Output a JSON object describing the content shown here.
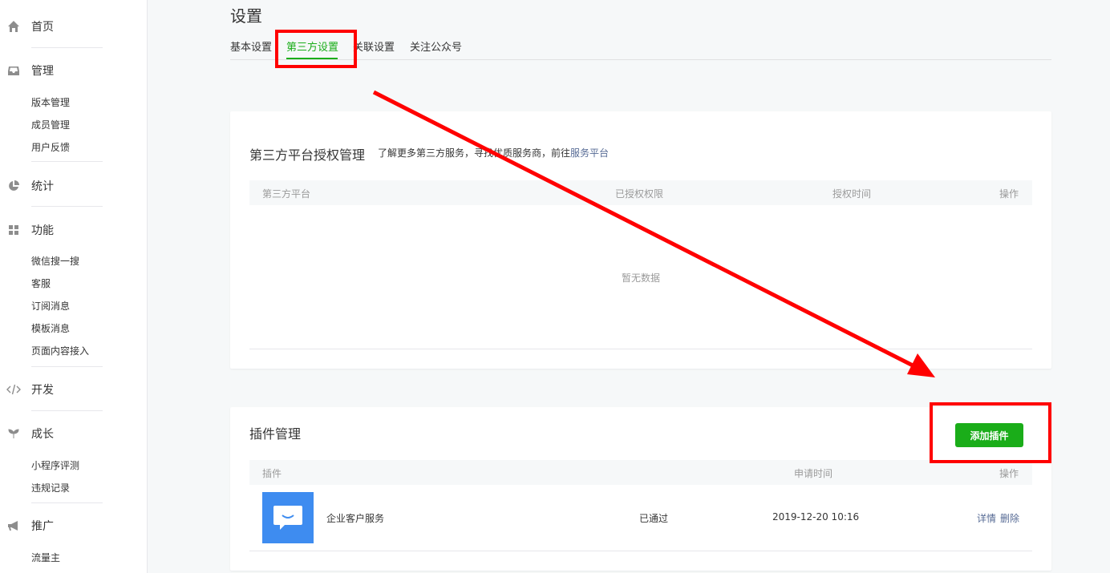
{
  "sidebar": {
    "home": {
      "label": "首页",
      "icon": "home-icon"
    },
    "manage": {
      "label": "管理",
      "icon": "inbox-icon",
      "items": [
        "版本管理",
        "成员管理",
        "用户反馈"
      ]
    },
    "stats": {
      "label": "统计",
      "icon": "pie-chart-icon"
    },
    "features": {
      "label": "功能",
      "icon": "grid-icon",
      "items": [
        "微信搜一搜",
        "客服",
        "订阅消息",
        "模板消息",
        "页面内容接入"
      ]
    },
    "develop": {
      "label": "开发",
      "icon": "code-icon"
    },
    "growth": {
      "label": "成长",
      "icon": "sprout-icon",
      "items": [
        "小程序评测",
        "违规记录"
      ]
    },
    "promote": {
      "label": "推广",
      "icon": "megaphone-icon",
      "items": [
        "流量主"
      ]
    }
  },
  "page": {
    "title": "设置",
    "tabs": [
      "基本设置",
      "第三方设置",
      "关联设置",
      "关注公众号"
    ],
    "active_tab": "第三方设置"
  },
  "third_party": {
    "title": "第三方平台授权管理",
    "desc_prefix": "了解更多第三方服务，寻找优质服务商，前往",
    "desc_link": "服务平台",
    "columns": [
      "第三方平台",
      "已授权权限",
      "授权时间",
      "操作"
    ],
    "empty_text": "暂无数据"
  },
  "plugins": {
    "title": "插件管理",
    "add_button": "添加插件",
    "columns": [
      "插件",
      "申请时间",
      "操作"
    ],
    "rows": [
      {
        "name": "企业客户服务",
        "status": "已通过",
        "time": "2019-12-20 10:16",
        "action_detail": "详情",
        "action_delete": "删除"
      }
    ]
  },
  "colors": {
    "accent": "#1aad19",
    "link": "#576b95",
    "annotation": "#ff0000",
    "plugin_logo": "#3e8cf0"
  }
}
